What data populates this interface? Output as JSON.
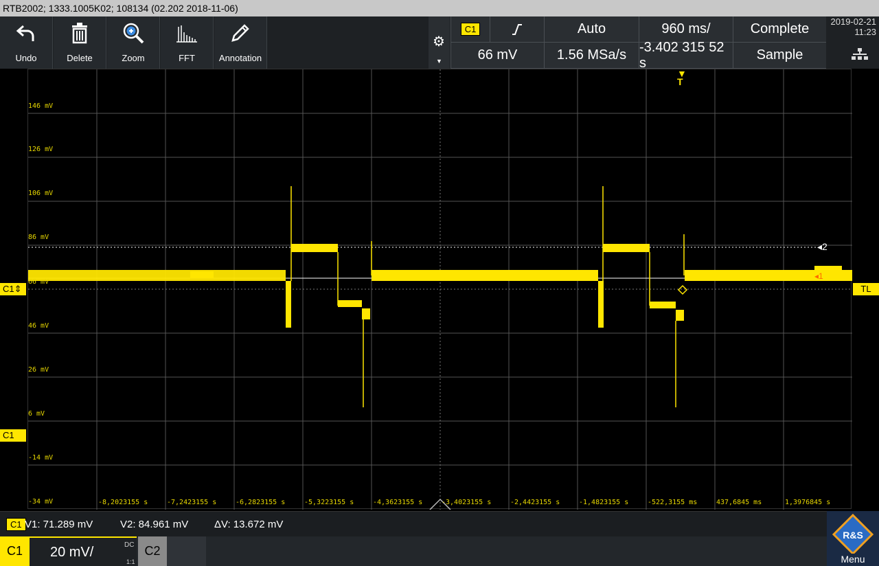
{
  "title_bar": "RTB2002; 1333.1005K02; 108134 (02.202 2018-11-06)",
  "toolbar": {
    "undo": "Undo",
    "delete": "Delete",
    "zoom": "Zoom",
    "fft": "FFT",
    "annotation": "Annotation"
  },
  "status": {
    "channel": "C1",
    "edge_icon": "rising-edge-icon",
    "trigger_mode": "Auto",
    "timebase": "960 ms/",
    "acq_state": "Complete",
    "trigger_level": "66 mV",
    "sample_rate": "1.56 MSa/s",
    "trigger_pos": "-3.402 315 52 s",
    "acq_mode": "Sample"
  },
  "datetime": {
    "date": "2019-02-21",
    "time": "11:23"
  },
  "plot": {
    "trigger_marker": "T",
    "y_labels": [
      "146 mV",
      "126 mV",
      "106 mV",
      "86 mV",
      "66 mV",
      "46 mV",
      "26 mV",
      "6 mV",
      "-14 mV",
      "-34 mV"
    ],
    "x_labels": [
      "-8,2023155 s",
      "-7,2423155 s",
      "-6,2823155 s",
      "-5,3223155 s",
      "-4,3623155 s",
      "-3,4023155 s",
      "-2,4423155 s",
      "-1,4823155 s",
      "-522,3155 ms",
      "437,6845 ms",
      "1,3976845 s"
    ],
    "cursor1_label": "1",
    "cursor2_label": "2",
    "c1_level_marker": "C1",
    "c1_offset_marker": "C1",
    "trigger_level_marker": "TL"
  },
  "measurements": {
    "channel": "C1",
    "v1": "V1: 71.289 mV",
    "v2": "V2: 84.961 mV",
    "dv": "ΔV: 13.672 mV"
  },
  "bottom": {
    "ch1": "C1",
    "ch1_scale": "20 mV/",
    "ch1_coupling": "DC",
    "ch1_ratio": "1:1",
    "ch2": "C2",
    "menu": "Menu",
    "menu_logo": "R&S"
  },
  "colors": {
    "trace": "#ffe600",
    "background": "#000000",
    "panel": "#2a2e32"
  }
}
